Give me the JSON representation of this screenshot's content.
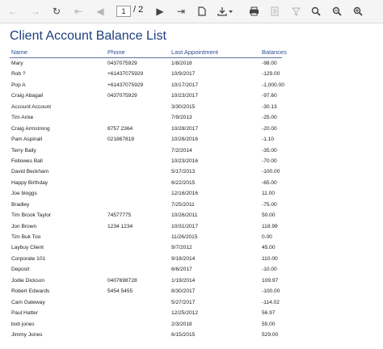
{
  "toolbar": {
    "current_page": "1",
    "page_total": "/ 2"
  },
  "report": {
    "title": "Client Account Balance List",
    "columns": {
      "name": "Name",
      "phone": "Phone",
      "last_appointment": "Last Appointment",
      "balances": "Balances"
    },
    "rows": [
      {
        "name": "Mary",
        "phone": "0437075929",
        "appt": "1/8/2018",
        "bal": "-98.00"
      },
      {
        "name": "Rob ?",
        "phone": "+61437075929",
        "appt": "10/9/2017",
        "bal": "-129.00"
      },
      {
        "name": "Pop A",
        "phone": "+61437075929",
        "appt": "10/17/2017",
        "bal": "-1,000.00"
      },
      {
        "name": "Craig Abagail",
        "phone": "0437075929",
        "appt": "10/23/2017",
        "bal": "-97.60"
      },
      {
        "name": "Account Account",
        "phone": "",
        "appt": "3/30/2015",
        "bal": "-30.13"
      },
      {
        "name": "Tim Amie",
        "phone": "",
        "appt": "7/9/2013",
        "bal": "-25.00"
      },
      {
        "name": "Craig Armstrong",
        "phone": "8757 2364",
        "appt": "10/28/2017",
        "bal": "-20.00"
      },
      {
        "name": "Pam Aspinall",
        "phone": "021867818",
        "appt": "10/26/2016",
        "bal": "-1.10"
      },
      {
        "name": "Terry Baily",
        "phone": "",
        "appt": "7/2/2014",
        "bal": "-35.00"
      },
      {
        "name": "Fellowes Ball",
        "phone": "",
        "appt": "10/23/2016",
        "bal": "-70.00"
      },
      {
        "name": "David Beckham",
        "phone": "",
        "appt": "5/17/2013",
        "bal": "-100.00"
      },
      {
        "name": "Happy Birthday",
        "phone": "",
        "appt": "6/22/2015",
        "bal": "-65.00"
      },
      {
        "name": "Joe bloggs",
        "phone": "",
        "appt": "12/16/2016",
        "bal": "11.00"
      },
      {
        "name": " Bradley",
        "phone": "",
        "appt": "7/25/2011",
        "bal": "-75.00"
      },
      {
        "name": "Tim Brook Taylor",
        "phone": "74577775",
        "appt": "10/26/2011",
        "bal": "50.00"
      },
      {
        "name": "Jon Brown",
        "phone": "1234 1234",
        "appt": "10/31/2017",
        "bal": "118.99"
      },
      {
        "name": "Tim Buk Too",
        "phone": "",
        "appt": "11/26/2015",
        "bal": "0.00"
      },
      {
        "name": "Laybuy Client",
        "phone": "",
        "appt": "9/7/2012",
        "bal": "45.00"
      },
      {
        "name": " Corporate 101",
        "phone": "",
        "appt": "9/18/2014",
        "bal": "110.00"
      },
      {
        "name": " Deposit",
        "phone": "",
        "appt": "6/6/2017",
        "bal": "-10.00"
      },
      {
        "name": "Jodie Dickson",
        "phone": "0407698728",
        "appt": "1/19/2014",
        "bal": "109.97"
      },
      {
        "name": "Robert Edwards",
        "phone": "5454 5455",
        "appt": "8/30/2017",
        "bal": "-100.00"
      },
      {
        "name": "Cam Gateway",
        "phone": "",
        "appt": "5/27/2017",
        "bal": "-114.02"
      },
      {
        "name": "Paul Hatter",
        "phone": "",
        "appt": "12/25/2012",
        "bal": "56.97"
      },
      {
        "name": "bob  jones",
        "phone": "",
        "appt": "2/3/2018",
        "bal": "55.00"
      },
      {
        "name": "Jimmy Jones",
        "phone": "",
        "appt": "6/15/2015",
        "bal": "529.00"
      }
    ]
  }
}
